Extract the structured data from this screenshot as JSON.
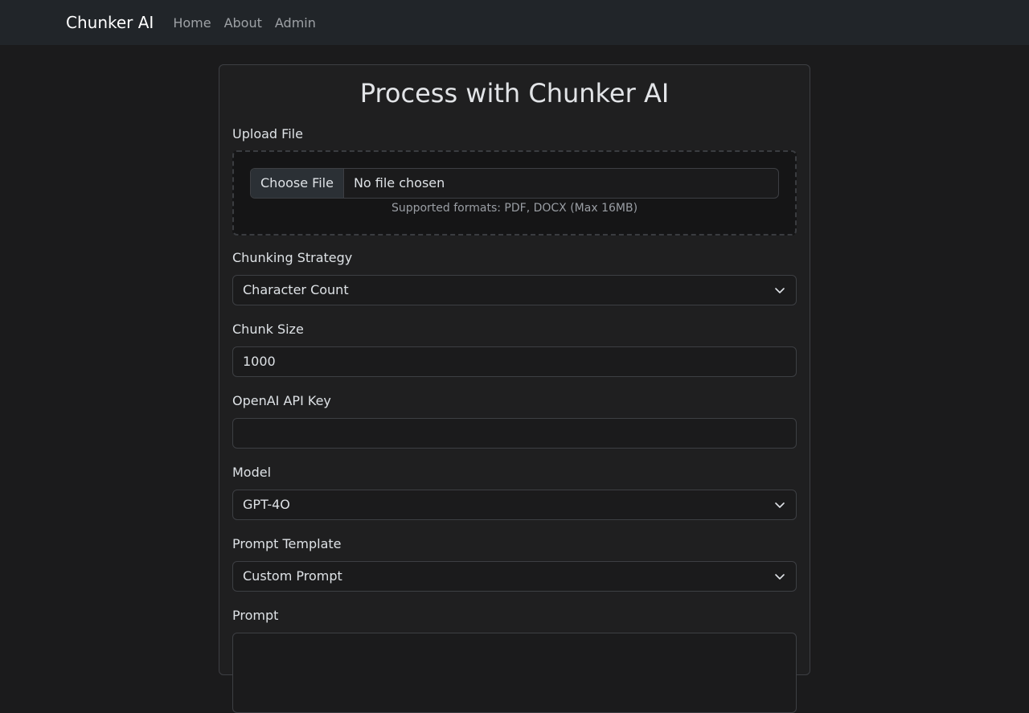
{
  "navbar": {
    "brand": "Chunker AI",
    "links": [
      "Home",
      "About",
      "Admin"
    ]
  },
  "card": {
    "title": "Process with Chunker AI"
  },
  "upload": {
    "label": "Upload File",
    "button": "Choose File",
    "status": "No file chosen",
    "hint": "Supported formats: PDF, DOCX (Max 16MB)"
  },
  "strategy": {
    "label": "Chunking Strategy",
    "value": "Character Count"
  },
  "chunk_size": {
    "label": "Chunk Size",
    "value": "1000"
  },
  "api_key": {
    "label": "OpenAI API Key",
    "value": ""
  },
  "model": {
    "label": "Model",
    "value": "GPT-4O"
  },
  "prompt_template": {
    "label": "Prompt Template",
    "value": "Custom Prompt"
  },
  "prompt": {
    "label": "Prompt",
    "value": ""
  },
  "colors": {
    "navbar_bg": "#212529",
    "page_bg": "#1b1b1c",
    "card_border": "#3d3f43"
  }
}
